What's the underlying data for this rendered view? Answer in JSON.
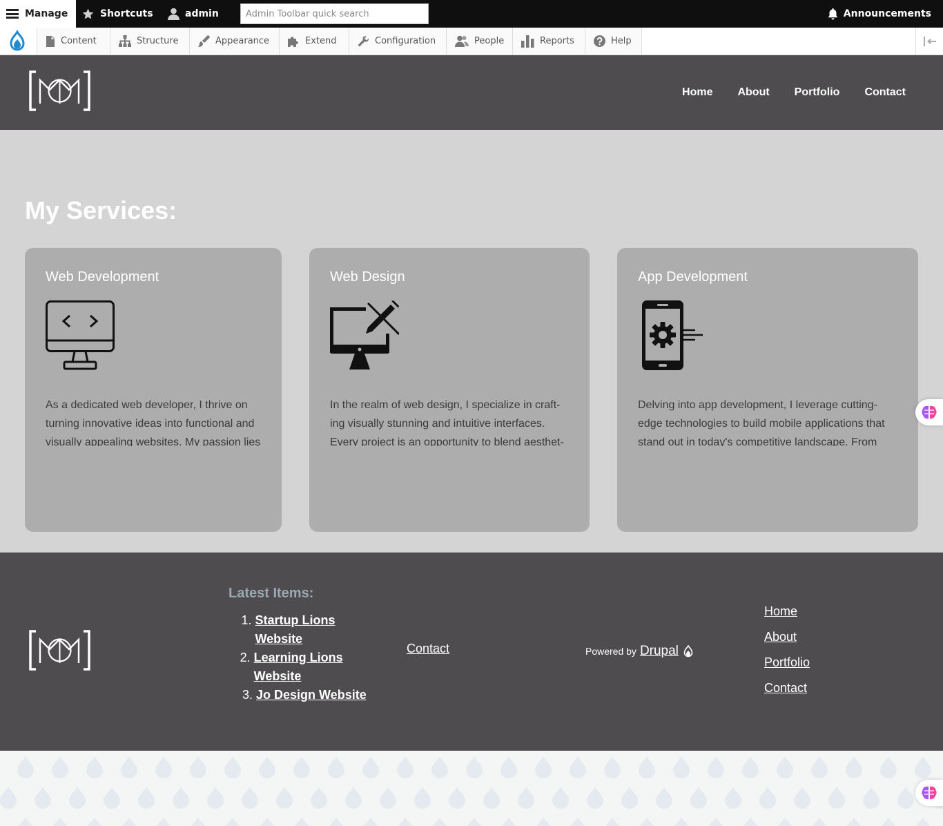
{
  "toolbar": {
    "manage_label": "Manage",
    "shortcuts_label": "Shortcuts",
    "user_label": "admin",
    "search_placeholder": "Admin Toolbar quick search",
    "announcements_label": "Announcements"
  },
  "tray": {
    "items": [
      {
        "label": "Content",
        "icon": "file-icon"
      },
      {
        "label": "Structure",
        "icon": "sitemap-icon"
      },
      {
        "label": "Appearance",
        "icon": "paintbrush-icon"
      },
      {
        "label": "Extend",
        "icon": "puzzle-icon"
      },
      {
        "label": "Configuration",
        "icon": "wrench-icon"
      },
      {
        "label": "People",
        "icon": "people-icon"
      },
      {
        "label": "Reports",
        "icon": "bar-chart-icon"
      },
      {
        "label": "Help",
        "icon": "help-icon"
      }
    ]
  },
  "header": {
    "nav": [
      "Home",
      "About",
      "Portfolio",
      "Contact"
    ]
  },
  "services": {
    "heading": "My Services:",
    "cards": [
      {
        "title": "Web Development",
        "icon": "monitor-code-icon",
        "text": "As a dedicated web developer, I thrive on turning innovative ideas into functional and visually appealing websites. My passion lies"
      },
      {
        "title": "Web Design",
        "icon": "monitor-pencil-icon",
        "text": "In the realm of web design, I specialize in craft-ing visually stunning and intuitive interfaces. Every project is an opportunity to blend aesthet-"
      },
      {
        "title": "App Development",
        "icon": "phone-gear-icon",
        "text": "Delving into app development, I leverage cutting-edge technologies to build mobile applications that stand out in today's competitive landscape. From"
      }
    ]
  },
  "footer": {
    "latest_title": "Latest Items:",
    "latest_items": [
      "Startup Lions Website",
      "Learning Lions Website",
      "Jo Design Website"
    ],
    "contact_label": "Contact",
    "powered_prefix": "Powered by",
    "powered_link": "Drupal",
    "nav": [
      "Home",
      "About",
      "Portfolio",
      "Contact"
    ]
  },
  "colors": {
    "toolbar_bg": "#0f0f0f",
    "header_bg": "#4e4c4e",
    "services_bg": "#d4d4d4",
    "card_bg": "#adadad",
    "drupal_blue": "#1f8bcc",
    "latest_title": "#9aa8b4"
  }
}
